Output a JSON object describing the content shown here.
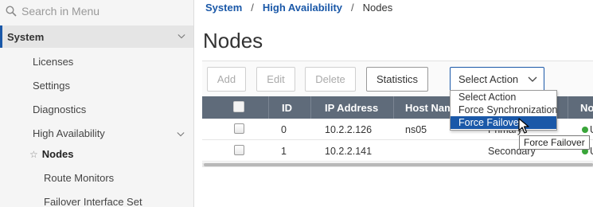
{
  "sidebar": {
    "search_placeholder": "Search in Menu",
    "section": "System",
    "items": [
      {
        "label": "Licenses"
      },
      {
        "label": "Settings"
      },
      {
        "label": "Diagnostics"
      },
      {
        "label": "High Availability"
      }
    ],
    "subitems": [
      {
        "label": "Nodes",
        "current": true
      },
      {
        "label": "Route Monitors"
      },
      {
        "label": "Failover Interface Set"
      }
    ]
  },
  "breadcrumb": {
    "items": [
      "System",
      "High Availability",
      "Nodes"
    ],
    "separator": "/"
  },
  "page": {
    "title": "Nodes"
  },
  "toolbar": {
    "add_label": "Add",
    "edit_label": "Edit",
    "delete_label": "Delete",
    "statistics_label": "Statistics",
    "action_select_value": "Select Action"
  },
  "action_menu": {
    "options": [
      "Select Action",
      "Force Synchronization",
      "Force Failover"
    ],
    "highlighted": "Force Failover",
    "tooltip": "Force Failover"
  },
  "table": {
    "columns": [
      "ID",
      "IP Address",
      "Host Nam",
      "No"
    ],
    "rows": [
      {
        "id": "0",
        "ip": "10.2.2.126",
        "host": "ns05",
        "state": "Primary",
        "node": "U"
      },
      {
        "id": "1",
        "ip": "10.2.2.141",
        "host": "",
        "state": "Secondary",
        "node": "U"
      }
    ]
  },
  "colors": {
    "brand_blue": "#1a58a8",
    "table_header": "#5f6b7a",
    "status_up": "#3aa53a"
  }
}
